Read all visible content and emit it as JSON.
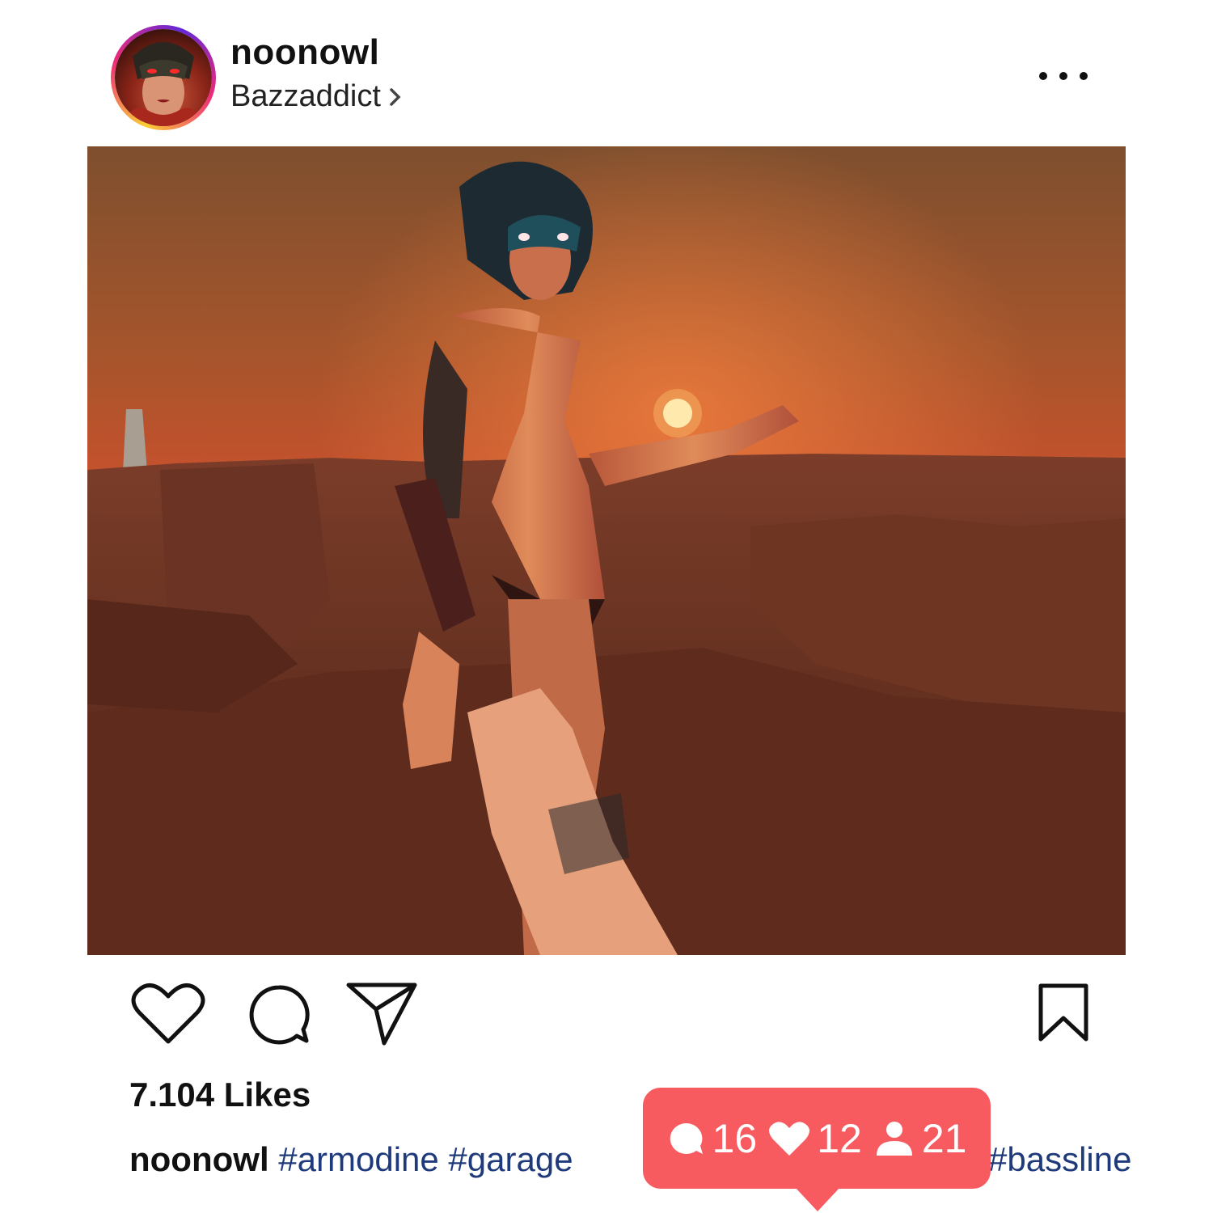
{
  "post": {
    "username": "noonowl",
    "subtitle": "Bazzaddict",
    "likes_text": "7.104 Likes"
  },
  "caption": {
    "username": "noonowl",
    "tags_left": "#armodine #garage",
    "tags_right": "#bassline"
  },
  "notification": {
    "comments": "16",
    "likes": "12",
    "follows": "21",
    "color": "#f75a5f"
  },
  "colors": {
    "hashtag": "#1f3a7a"
  },
  "icons": [
    "chevron-right-icon",
    "more-options-icon",
    "heart-icon",
    "comment-icon",
    "send-icon",
    "bookmark-icon",
    "person-icon"
  ]
}
